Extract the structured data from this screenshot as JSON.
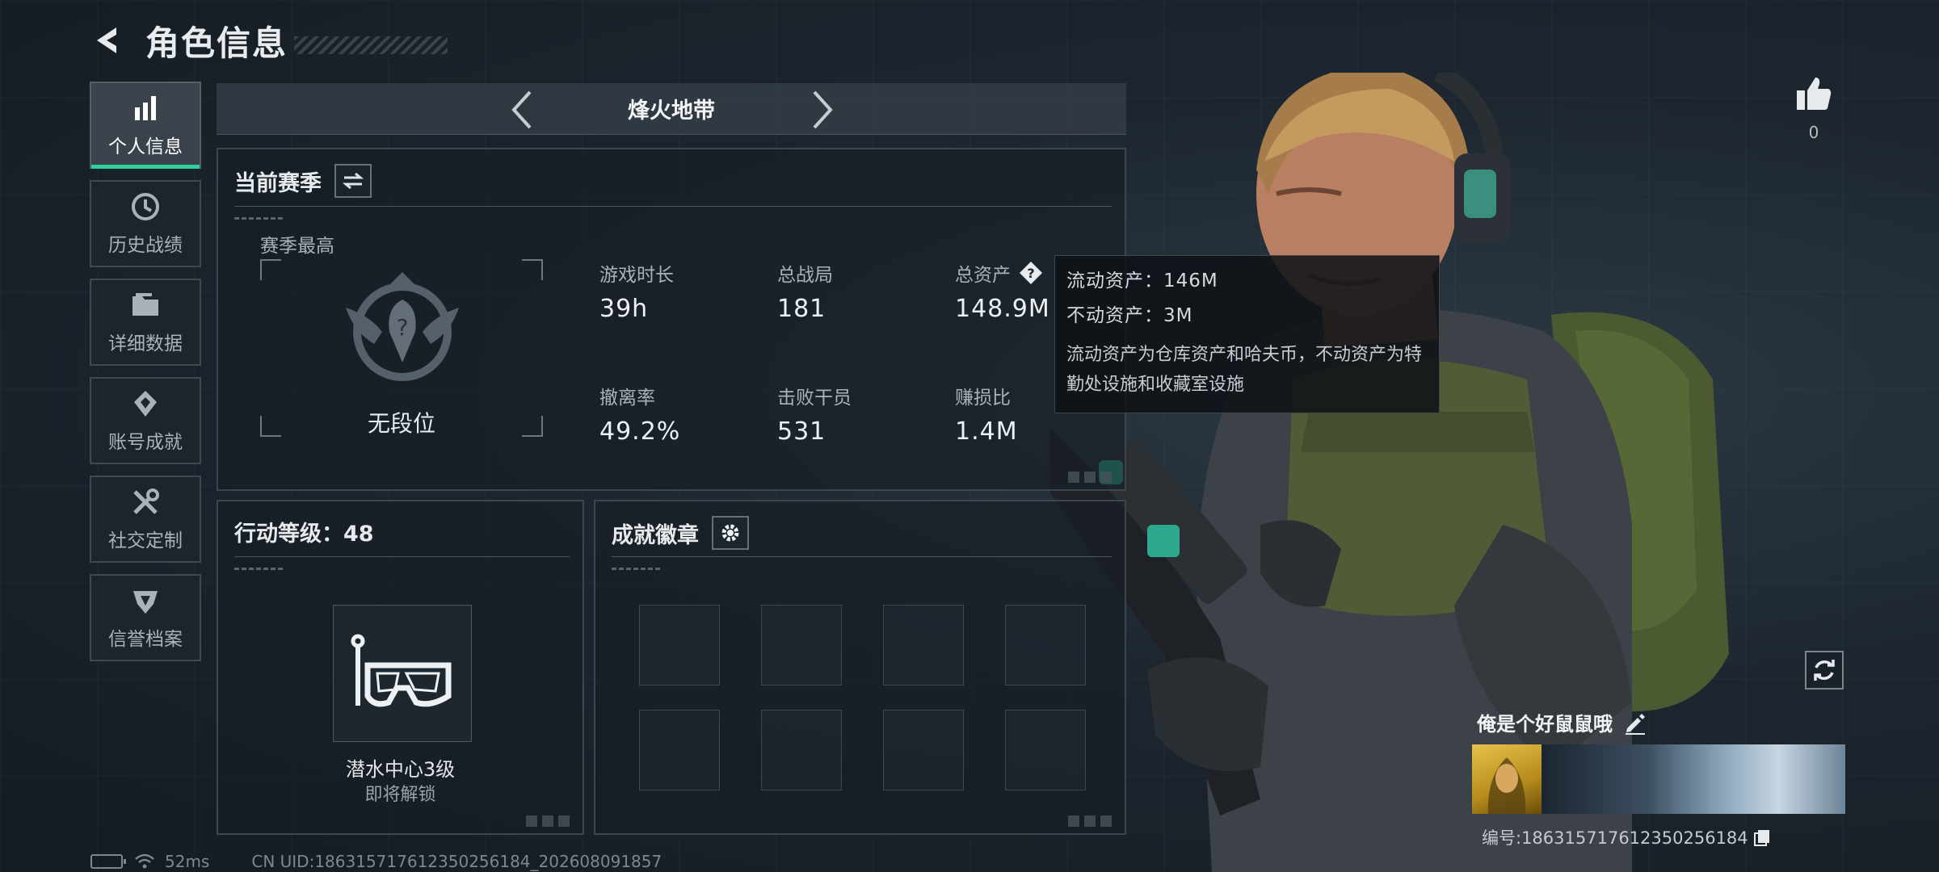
{
  "header": {
    "title": "角色信息"
  },
  "sidebar": {
    "items": [
      {
        "label": "个人信息",
        "active": true,
        "icon": "bar-chart-icon"
      },
      {
        "label": "历史战绩",
        "active": false,
        "icon": "history-icon"
      },
      {
        "label": "详细数据",
        "active": false,
        "icon": "folder-icon"
      },
      {
        "label": "账号成就",
        "active": false,
        "icon": "achievement-icon"
      },
      {
        "label": "社交定制",
        "active": false,
        "icon": "tools-icon"
      },
      {
        "label": "信誉档案",
        "active": false,
        "icon": "reputation-icon"
      }
    ]
  },
  "mode": {
    "title": "烽火地带"
  },
  "season": {
    "title": "当前赛季",
    "best_label": "赛季最高",
    "rank": "无段位",
    "stats": [
      {
        "label": "游戏时长",
        "value": "39h"
      },
      {
        "label": "总战局",
        "value": "181"
      },
      {
        "label": "总资产",
        "value": "148.9M"
      },
      {
        "label": "撤离率",
        "value": "49.2%"
      },
      {
        "label": "击败干员",
        "value": "531"
      },
      {
        "label": "赚损比",
        "value": "1.4M"
      }
    ]
  },
  "tooltip": {
    "liquid": "流动资产：146M",
    "fixed": "不动资产：3M",
    "desc": "流动资产为仓库资产和哈夫币，不动资产为特勤处设施和收藏室设施"
  },
  "level": {
    "title": "行动等级：48",
    "badge_name": "潜水中心3级",
    "badge_status": "即将解锁"
  },
  "achievements": {
    "title": "成就徽章"
  },
  "like": {
    "count": "0"
  },
  "profile": {
    "nickname": "俺是个好鼠鼠哦",
    "uid": "编号:1863157176123502561​84"
  },
  "status": {
    "ping": "52ms",
    "cn_uid": "CN UID:186315717612350256184_202608091857"
  },
  "colors": {
    "accent": "#2fd09c",
    "background": "#1a222b"
  }
}
